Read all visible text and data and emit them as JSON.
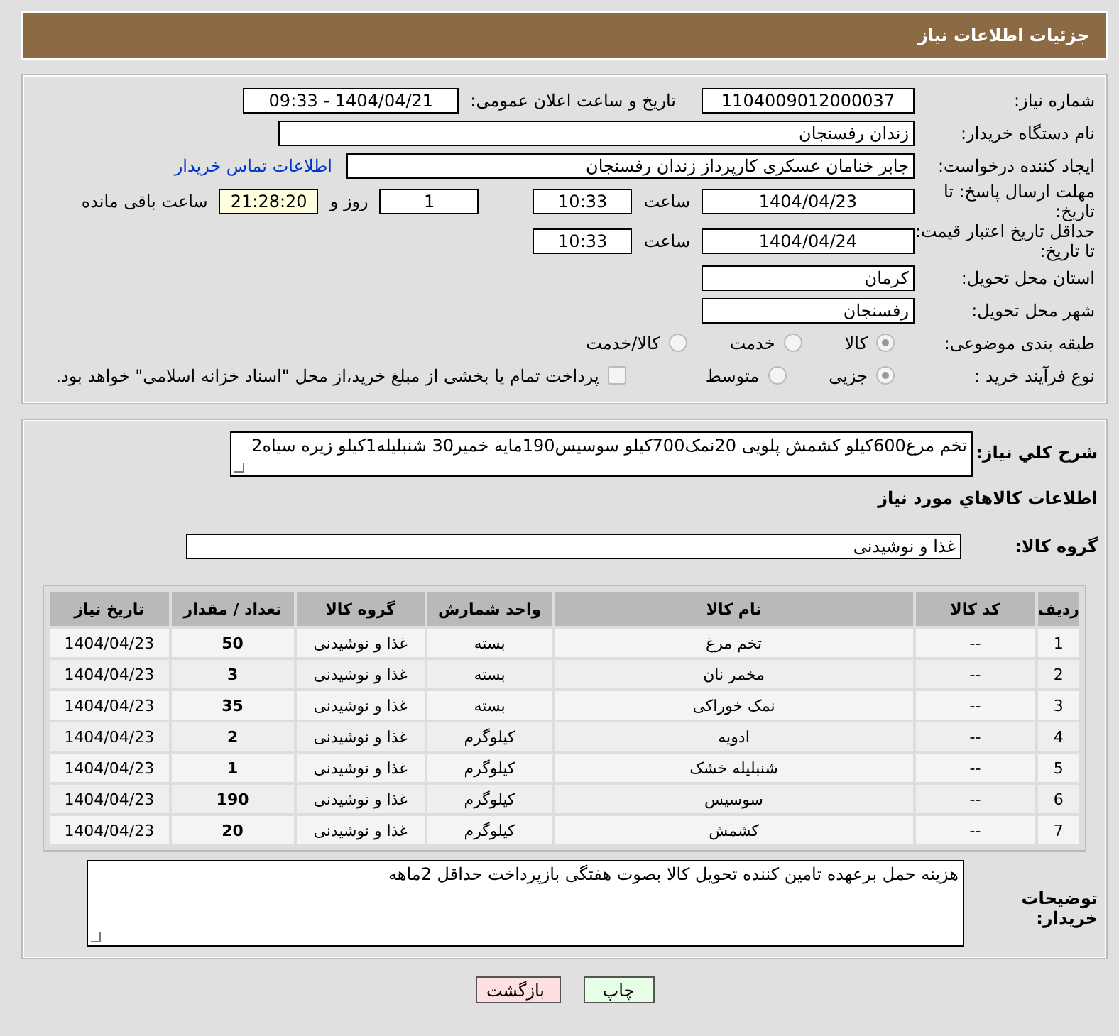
{
  "header": {
    "title": "جزئیات اطلاعات نیاز"
  },
  "details": {
    "need_number": {
      "label": "شماره نیاز:",
      "value": "1104009012000037"
    },
    "announce": {
      "label": "تاریخ و ساعت اعلان عمومی:",
      "value": "1404/04/21 - 09:33"
    },
    "buyer": {
      "label": "نام دستگاه خریدار:",
      "value": "زندان رفسنجان"
    },
    "creator": {
      "label": "ایجاد کننده درخواست:",
      "value": "جابر خنامان عسکری کارپرداز زندان رفسنجان",
      "link": "اطلاعات تماس خریدار"
    },
    "deadline": {
      "label": "مهلت ارسال پاسخ: تا تاریخ:",
      "date": "1404/04/23",
      "time_label": "ساعت",
      "time": "10:33",
      "days": "1",
      "days_label": "روز و",
      "remaining": "21:28:20",
      "remaining_label": "ساعت باقی مانده"
    },
    "validity": {
      "label": "حداقل تاریخ اعتبار قیمت: تا تاریخ:",
      "date": "1404/04/24",
      "time_label": "ساعت",
      "time": "10:33"
    },
    "province": {
      "label": "استان محل تحویل:",
      "value": "کرمان"
    },
    "city": {
      "label": "شهر محل تحویل:",
      "value": "رفسنجان"
    },
    "category": {
      "label": "طبقه بندی موضوعی:",
      "options": [
        {
          "label": "کالا",
          "selected": true
        },
        {
          "label": "خدمت",
          "selected": false
        },
        {
          "label": "کالا/خدمت",
          "selected": false
        }
      ]
    },
    "process": {
      "label": "نوع فرآیند خرید :",
      "options": [
        {
          "label": "جزیی",
          "selected": true
        },
        {
          "label": "متوسط",
          "selected": false
        }
      ],
      "treasury": {
        "label": "پرداخت تمام یا بخشی از مبلغ خرید،از محل \"اسناد خزانه اسلامی\" خواهد بود.",
        "checked": false
      }
    }
  },
  "need": {
    "description_label": "شرح کلي نياز:",
    "description": "تخم مرغ600کیلو کشمش پلویی 20نمک700کیلو سوسیس190مایه خمیر30 شنبلیله1کیلو زیره سیاه2",
    "goods_title": "اطلاعات کالاهاي مورد نياز",
    "group_label": "گروه کالا:",
    "group": "غذا و نوشیدنی",
    "table": {
      "columns": [
        "ردیف",
        "کد کالا",
        "نام کالا",
        "واحد شمارش",
        "گروه کالا",
        "تعداد / مقدار",
        "تاریخ نیاز"
      ],
      "rows": [
        [
          "1",
          "--",
          "تخم مرغ",
          "بسته",
          "غذا و نوشیدنی",
          "50",
          "1404/04/23"
        ],
        [
          "2",
          "--",
          "مخمر نان",
          "بسته",
          "غذا و نوشیدنی",
          "3",
          "1404/04/23"
        ],
        [
          "3",
          "--",
          "نمک خوراکی",
          "بسته",
          "غذا و نوشیدنی",
          "35",
          "1404/04/23"
        ],
        [
          "4",
          "--",
          "ادویه",
          "کیلوگرم",
          "غذا و نوشیدنی",
          "2",
          "1404/04/23"
        ],
        [
          "5",
          "--",
          "شنبلیله خشک",
          "کیلوگرم",
          "غذا و نوشیدنی",
          "1",
          "1404/04/23"
        ],
        [
          "6",
          "--",
          "سوسیس",
          "کیلوگرم",
          "غذا و نوشیدنی",
          "190",
          "1404/04/23"
        ],
        [
          "7",
          "--",
          "کشمش",
          "کیلوگرم",
          "غذا و نوشیدنی",
          "20",
          "1404/04/23"
        ]
      ]
    },
    "notes_label": "توضیحات خریدار:",
    "notes": "هزینه حمل برعهده تامین کننده تحویل کالا بصوت هفتگی بازپرداخت حداقل 2ماهه"
  },
  "buttons": [
    {
      "kind": "print",
      "label": "چاپ"
    },
    {
      "kind": "back",
      "label": "بازگشت"
    }
  ]
}
